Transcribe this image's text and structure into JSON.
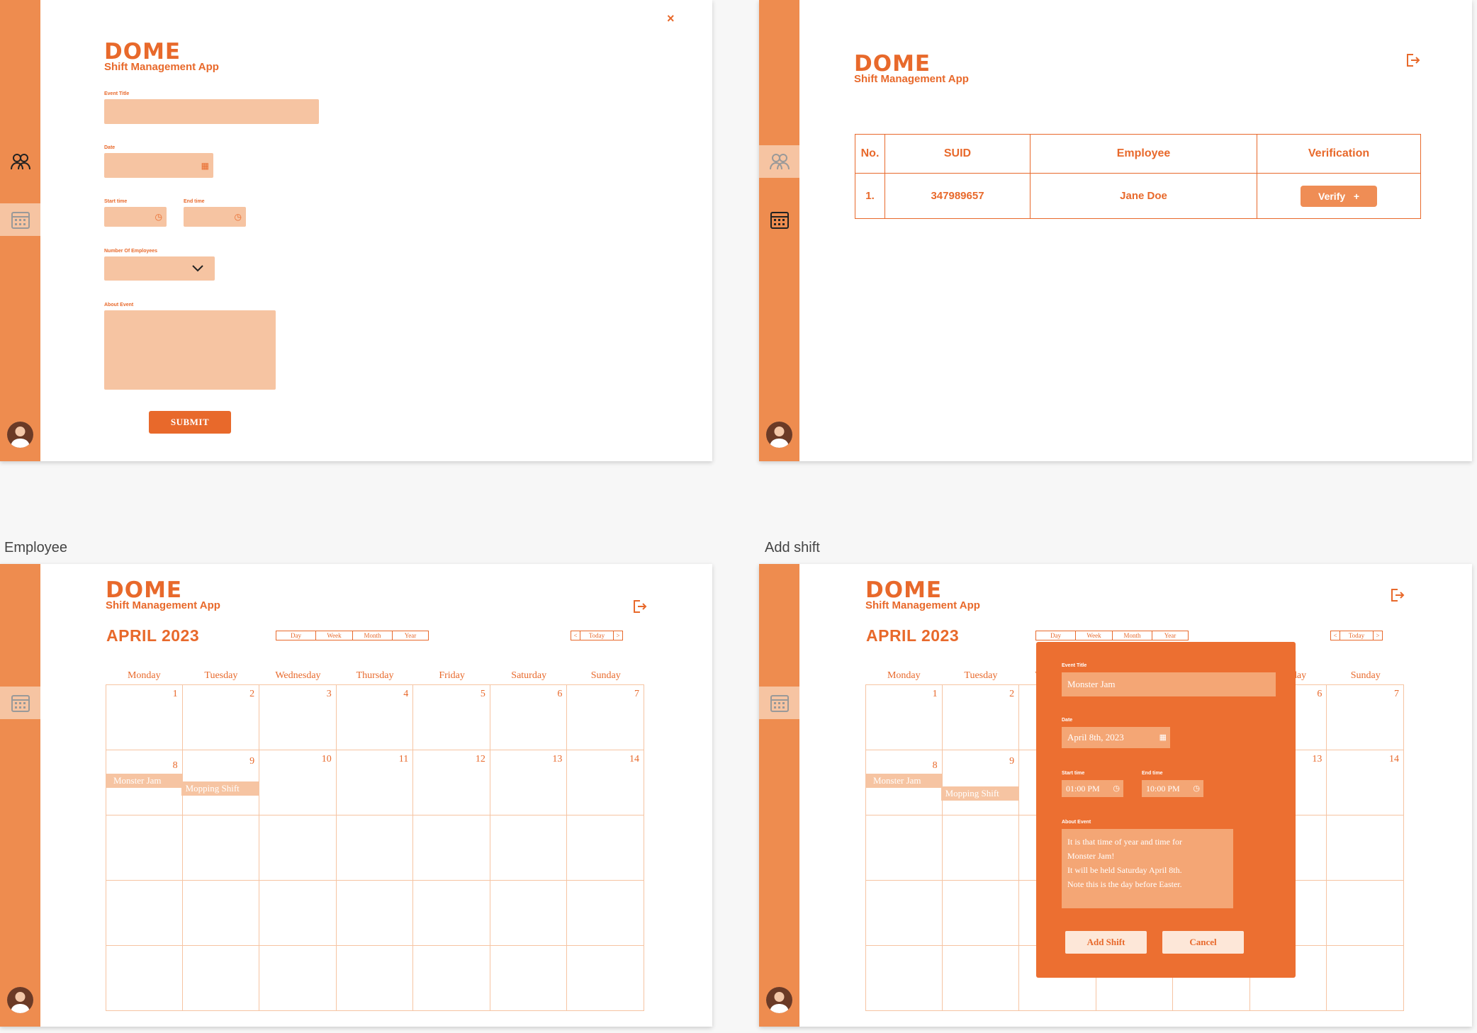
{
  "app": {
    "logo": "DOME",
    "tagline": "Shift Management App"
  },
  "create_event": {
    "close_glyph": "×",
    "event_title_label": "Event Title",
    "date_label": "Date",
    "start_time_label": "Start time",
    "end_time_label": "End time",
    "num_employees_label": "Number Of Employees",
    "about_label": "About Event",
    "submit_label": "SUBMIT"
  },
  "verification": {
    "headers": [
      "No.",
      "SUID",
      "Employee",
      "Verification"
    ],
    "rows": [
      {
        "no": "1.",
        "suid": "347989657",
        "employee": "Jane Doe",
        "action": "Verify",
        "action_icon": "+"
      }
    ]
  },
  "employee_frame": {
    "title": "Employee"
  },
  "add_shift_frame": {
    "title": "Add shift"
  },
  "calendar": {
    "month": "APRIL 2023",
    "views": [
      "Day",
      "Week",
      "Month",
      "Year"
    ],
    "nav": {
      "prev": "<",
      "today": "Today",
      "next": ">"
    },
    "weekdays": [
      "Monday",
      "Tuesday",
      "Wednesday",
      "Thursday",
      "Friday",
      "Saturday",
      "Sunday"
    ],
    "days": [
      "1",
      "2",
      "3",
      "4",
      "5",
      "6",
      "7",
      "8",
      "9",
      "10",
      "11",
      "12",
      "13",
      "14"
    ],
    "events": [
      {
        "name": "Monster Jam",
        "day": "8"
      },
      {
        "name": "Mopping Shift",
        "day": "9"
      }
    ]
  },
  "add_shift_modal": {
    "event_title_label": "Event Title",
    "event_title_value": "Monster Jam",
    "date_label": "Date",
    "date_value": "April 8th, 2023",
    "start_time_label": "Start time",
    "start_time_value": "01:00 PM",
    "end_time_label": "End time",
    "end_time_value": "10:00 PM",
    "about_label": "About Event",
    "about_lines": [
      "It is that time of year and time for",
      "Monster Jam!",
      "It will be held Saturday April 8th.",
      "Note this is the day before Easter."
    ],
    "add_label": "Add Shift",
    "cancel_label": "Cancel"
  },
  "colors": {
    "accent": "#e8692b",
    "sidebar": "#ee8c4f",
    "field": "#f6c4a2",
    "modal": "#ec6f31"
  }
}
